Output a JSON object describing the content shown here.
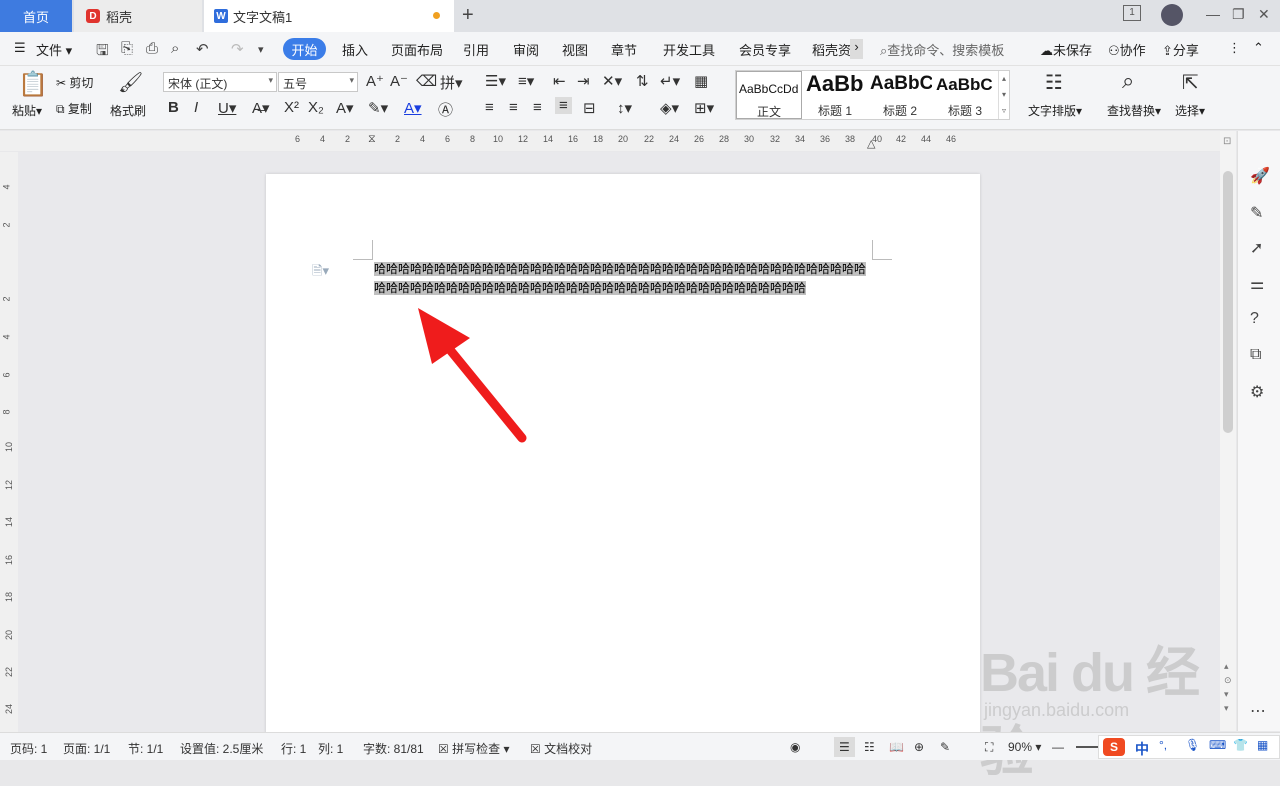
{
  "tabs": {
    "home": "首页",
    "daoke": "稻壳",
    "document": "文字文稿1"
  },
  "window": {
    "page_indicator": "1"
  },
  "menu": {
    "file": "文件",
    "items": [
      "开始",
      "插入",
      "页面布局",
      "引用",
      "审阅",
      "视图",
      "章节",
      "开发工具",
      "会员专享",
      "稻壳资"
    ],
    "search_placeholder": "查找命令、搜索模板",
    "unsaved": "未保存",
    "collab": "协作",
    "share": "分享"
  },
  "ribbon": {
    "paste": "粘贴",
    "cut": "剪切",
    "copy": "复制",
    "format_painter": "格式刷",
    "font_name": "宋体 (正文)",
    "font_size": "五号",
    "styles": [
      {
        "sample": "AaBbCcDd",
        "name": "正文"
      },
      {
        "sample": "AaBb",
        "name": "标题 1"
      },
      {
        "sample": "AaBbC",
        "name": "标题 2"
      },
      {
        "sample": "AaBbC",
        "name": "标题 3"
      }
    ],
    "text_layout": "文字排版",
    "find_replace": "查找替换",
    "select": "选择"
  },
  "ruler": {
    "horizontal": [
      "6",
      "4",
      "2",
      "2",
      "4",
      "6",
      "8",
      "10",
      "12",
      "14",
      "16",
      "18",
      "20",
      "22",
      "24",
      "26",
      "28",
      "30",
      "32",
      "34",
      "36",
      "38",
      "40",
      "42",
      "44",
      "46"
    ],
    "vertical": [
      "4",
      "2",
      "2",
      "4",
      "6",
      "8",
      "10",
      "12",
      "14",
      "16",
      "18",
      "20",
      "22",
      "24"
    ]
  },
  "document": {
    "text": "哈哈哈哈哈哈哈哈哈哈哈哈哈哈哈哈哈哈哈哈哈哈哈哈哈哈哈哈哈哈哈哈哈哈哈哈哈哈哈哈哈哈哈哈哈哈哈哈哈哈哈哈哈哈哈哈哈哈哈哈哈哈哈哈哈哈哈哈哈哈哈哈哈哈哈哈哈"
  },
  "status": {
    "page_no": "页码: 1",
    "pages": "页面: 1/1",
    "section": "节: 1/1",
    "setting": "设置值: 2.5厘米",
    "line": "行: 1",
    "column": "列: 1",
    "wordcount": "字数: 81/81",
    "spellcheck": "拼写检查",
    "proofread": "文档校对",
    "zoom": "90%"
  },
  "ime": {
    "lang": "中"
  },
  "watermark": {
    "brand": "Bai du 经验",
    "url": "jingyan.baidu.com"
  },
  "colors": {
    "accent": "#3b7de8",
    "selection": "#bfbfbf",
    "arrow": "#ef1c1c"
  }
}
